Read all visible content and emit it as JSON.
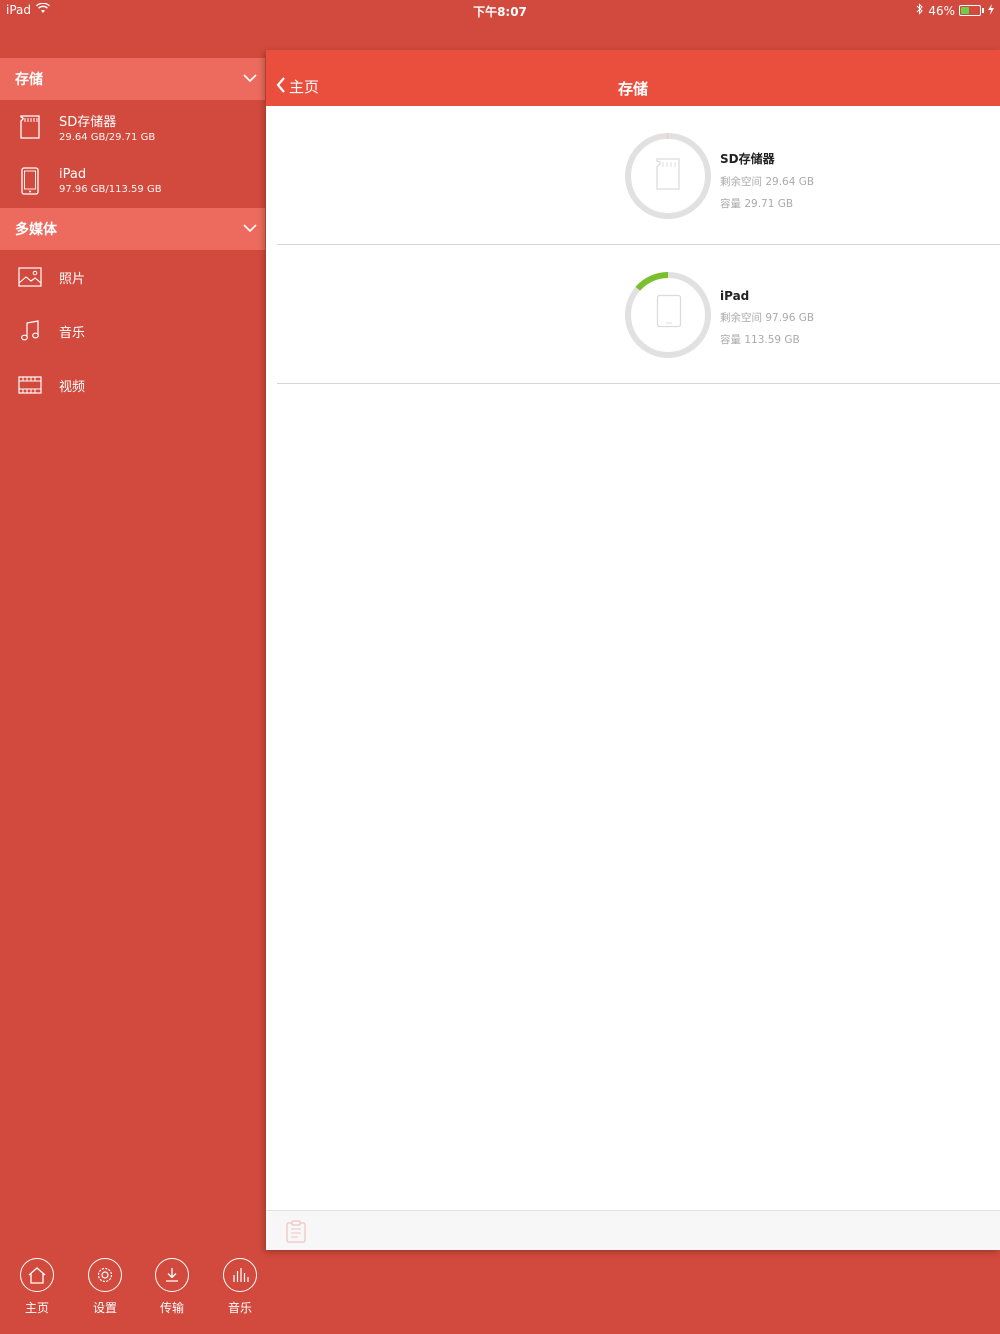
{
  "status_bar": {
    "device": "iPad",
    "time": "下午8:07",
    "battery": "46%",
    "battery_level": 0.46,
    "icons": [
      "wifi-icon",
      "bluetooth-icon",
      "battery-icon",
      "charging-icon"
    ]
  },
  "sidebar": {
    "sections": [
      {
        "title": "存储",
        "items": [
          {
            "name": "SD存储器",
            "detail": "29.64 GB/29.71 GB",
            "icon": "sd-card-icon"
          },
          {
            "name": "iPad",
            "detail": "97.96 GB/113.59 GB",
            "icon": "ipad-icon"
          }
        ]
      },
      {
        "title": "多媒体",
        "items": [
          {
            "name": "照片",
            "icon": "photo-icon"
          },
          {
            "name": "音乐",
            "icon": "music-icon"
          },
          {
            "name": "视频",
            "icon": "video-icon"
          }
        ]
      }
    ]
  },
  "tabs": [
    {
      "label": "主页",
      "icon": "home-icon"
    },
    {
      "label": "设置",
      "icon": "gear-icon"
    },
    {
      "label": "传输",
      "icon": "download-icon"
    },
    {
      "label": "音乐",
      "icon": "equalizer-icon"
    }
  ],
  "main": {
    "back_label": "主页",
    "title": "存储",
    "devices": [
      {
        "name": "SD存储器",
        "free": "剩余空间 29.64 GB",
        "capacity": "容量 29.71 GB",
        "used_fraction": 0.0024,
        "icon": "sd-card-icon"
      },
      {
        "name": "iPad",
        "free": "剩余空间 97.96 GB",
        "capacity": "容量 113.59 GB",
        "used_fraction": 0.1376,
        "icon": "ipad-icon"
      }
    ],
    "toolbar_icon": "clipboard-icon"
  },
  "colors": {
    "background": "#d24a3d",
    "section_header": "#ec6b5e",
    "navbar": "#ea4e3d",
    "ring_track": "#e1e1e1",
    "ring_used_sd": "#f0c9a6",
    "ring_used_ipad": "#7bbf2d"
  }
}
